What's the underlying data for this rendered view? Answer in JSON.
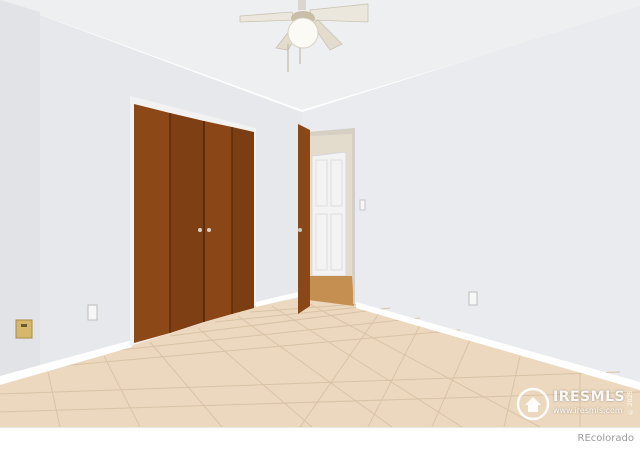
{
  "photo": {
    "subject": "Empty bedroom with wooden bifold closet, open doorway, ceiling fan and beige tile floor",
    "colors": {
      "walls": "#e7e9ec",
      "ceiling": "#eeeff0",
      "closet_wood": "#8a4717",
      "floor_tile": "#ecd7bc",
      "baseboard": "#ffffff",
      "hall_floor": "#c58f52"
    }
  },
  "watermark": {
    "brand": "IRES",
    "brand_suffix": "MLS",
    "site": "www.iresmls.com",
    "vertical_text": "© 2025",
    "icon": "house-in-circle-icon"
  },
  "footer": {
    "credit": "REcolorado"
  }
}
